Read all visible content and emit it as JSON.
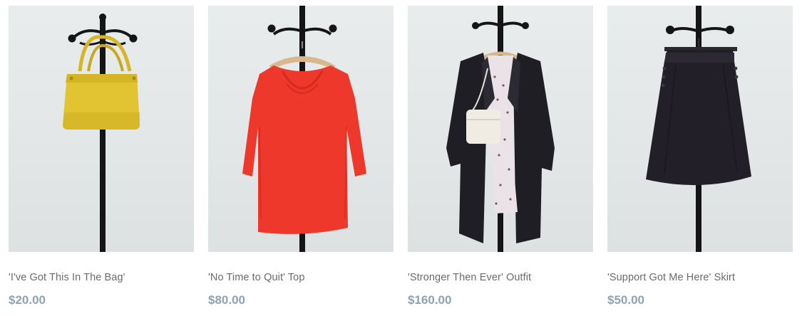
{
  "products": [
    {
      "name": "'I've Got This In The Bag'",
      "price": "$20.00",
      "image": "yellow-handbag-on-coat-rack",
      "color": "#e0c22f"
    },
    {
      "name": "'No Time to Quit' Top",
      "price": "$80.00",
      "image": "red-top-on-coat-rack",
      "color": "#ef3a2e"
    },
    {
      "name": "'Stronger Then Ever' Outfit",
      "price": "$160.00",
      "image": "black-coat-outfit-on-coat-rack",
      "color": "#1e1d24"
    },
    {
      "name": "'Support Got Me Here' Skirt",
      "price": "$50.00",
      "image": "black-skirt-on-coat-rack",
      "color": "#231f29"
    }
  ]
}
